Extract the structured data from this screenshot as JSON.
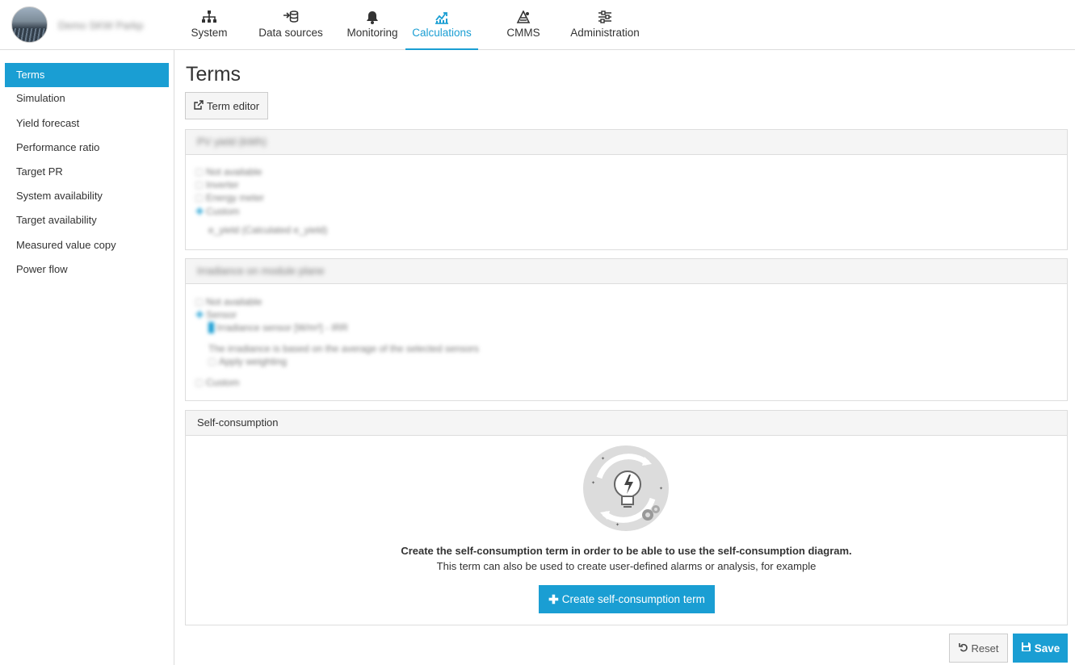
{
  "header": {
    "account_name": "Demo SKW Parkp",
    "nav": [
      {
        "label": "System",
        "icon": "sitemap-icon"
      },
      {
        "label": "Data sources",
        "icon": "data-import-icon"
      },
      {
        "label": "Monitoring",
        "icon": "bell-icon"
      },
      {
        "label": "Calculations",
        "icon": "chart-line-icon",
        "active": true
      },
      {
        "label": "CMMS",
        "icon": "tools-icon"
      },
      {
        "label": "Administration",
        "icon": "sliders-icon"
      }
    ]
  },
  "sidebar": {
    "items": [
      {
        "label": "Terms",
        "active": true
      },
      {
        "label": "Simulation"
      },
      {
        "label": "Yield forecast"
      },
      {
        "label": "Performance ratio"
      },
      {
        "label": "Target PR"
      },
      {
        "label": "System availability"
      },
      {
        "label": "Target availability"
      },
      {
        "label": "Measured value copy"
      },
      {
        "label": "Power flow"
      }
    ]
  },
  "main": {
    "title": "Terms",
    "term_editor_label": "Term editor",
    "panels": [
      {
        "title": "PV yield (kWh)",
        "lines": [
          "Not available",
          "Inverter",
          "Energy meter",
          "Custom",
          "e_yield (Calculated e_yield)"
        ]
      },
      {
        "title": "Irradiance on module plane",
        "lines": [
          "Not available",
          "Sensor",
          "Irradiance sensor [W/m²] - IRR",
          "The irradiance is based on the average of the selected sensors",
          "Apply weighting",
          "Custom"
        ]
      }
    ],
    "self_consumption": {
      "title": "Self-consumption",
      "headline": "Create the self-consumption term in order to be able to use the self-consumption diagram.",
      "subline": "This term can also be used to create user-defined alarms or analysis, for example",
      "create_label": "Create self-consumption term"
    },
    "footer": {
      "reset_label": "Reset",
      "save_label": "Save"
    }
  },
  "colors": {
    "accent": "#1a9ed3",
    "border": "#dddddd",
    "panel_header": "#f5f5f5"
  }
}
